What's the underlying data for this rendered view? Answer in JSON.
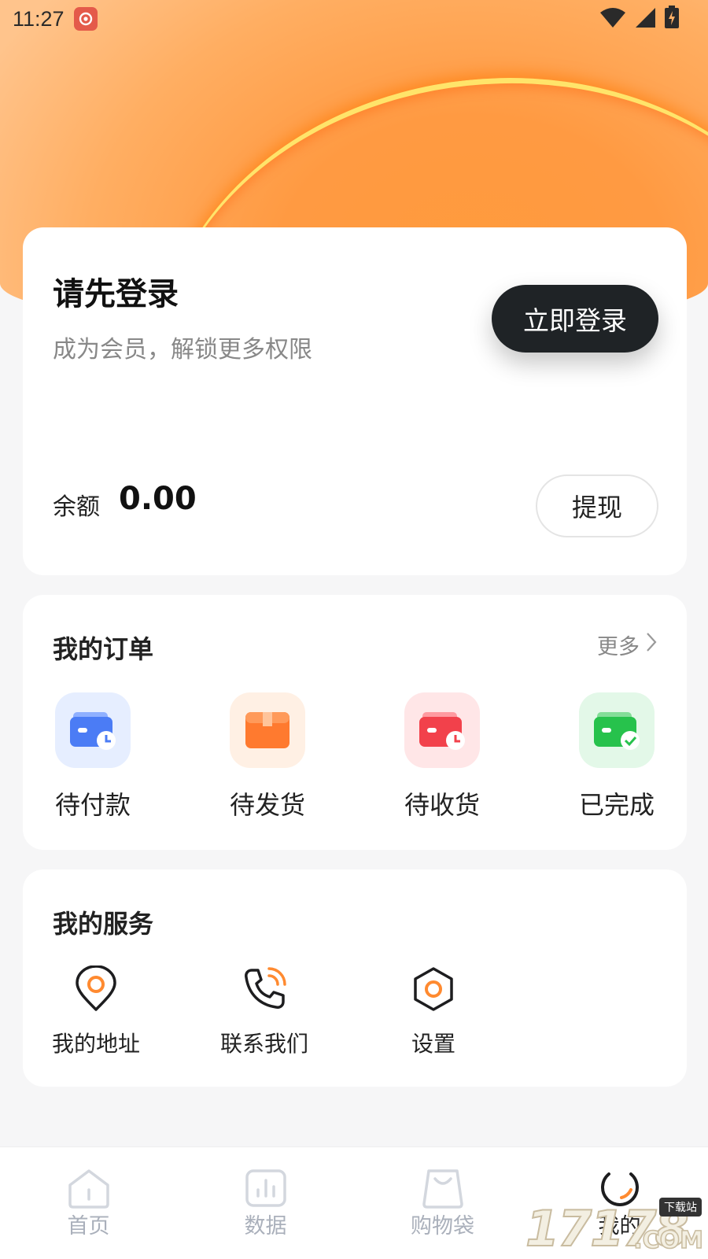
{
  "status_bar": {
    "time": "11:27"
  },
  "login_card": {
    "title": "请先登录",
    "subtitle": "成为会员，解锁更多权限",
    "login_button": "立即登录",
    "balance_label": "余额",
    "balance_value": "0.00",
    "withdraw_button": "提现"
  },
  "orders": {
    "title": "我的订单",
    "more": "更多",
    "items": [
      {
        "label": "待付款",
        "icon": "wallet-clock-icon",
        "color": "#4b7cf5",
        "bg": "#e6eeff"
      },
      {
        "label": "待发货",
        "icon": "box-icon",
        "color": "#ff7a2f",
        "bg": "#fff0e4"
      },
      {
        "label": "待收货",
        "icon": "wallet-clock-icon",
        "color": "#f2414b",
        "bg": "#ffe6e7"
      },
      {
        "label": "已完成",
        "icon": "wallet-check-icon",
        "color": "#27c24c",
        "bg": "#e3f8e8"
      }
    ]
  },
  "services": {
    "title": "我的服务",
    "items": [
      {
        "label": "我的地址",
        "icon": "location-pin-icon"
      },
      {
        "label": "联系我们",
        "icon": "phone-call-icon"
      },
      {
        "label": "设置",
        "icon": "settings-hexagon-icon"
      }
    ]
  },
  "tabbar": {
    "items": [
      {
        "label": "首页",
        "icon": "home-icon"
      },
      {
        "label": "数据",
        "icon": "chart-icon"
      },
      {
        "label": "购物袋",
        "icon": "shopping-bag-icon"
      },
      {
        "label": "我的",
        "icon": "profile-ring-icon",
        "active": true
      }
    ]
  },
  "watermark": {
    "number": "17178",
    "tag": "下载站",
    "suffix": ".COM"
  },
  "colors": {
    "accent": "#ff8a30",
    "dark_button": "#1f2326",
    "inactive_tab": "#aab0bb"
  }
}
